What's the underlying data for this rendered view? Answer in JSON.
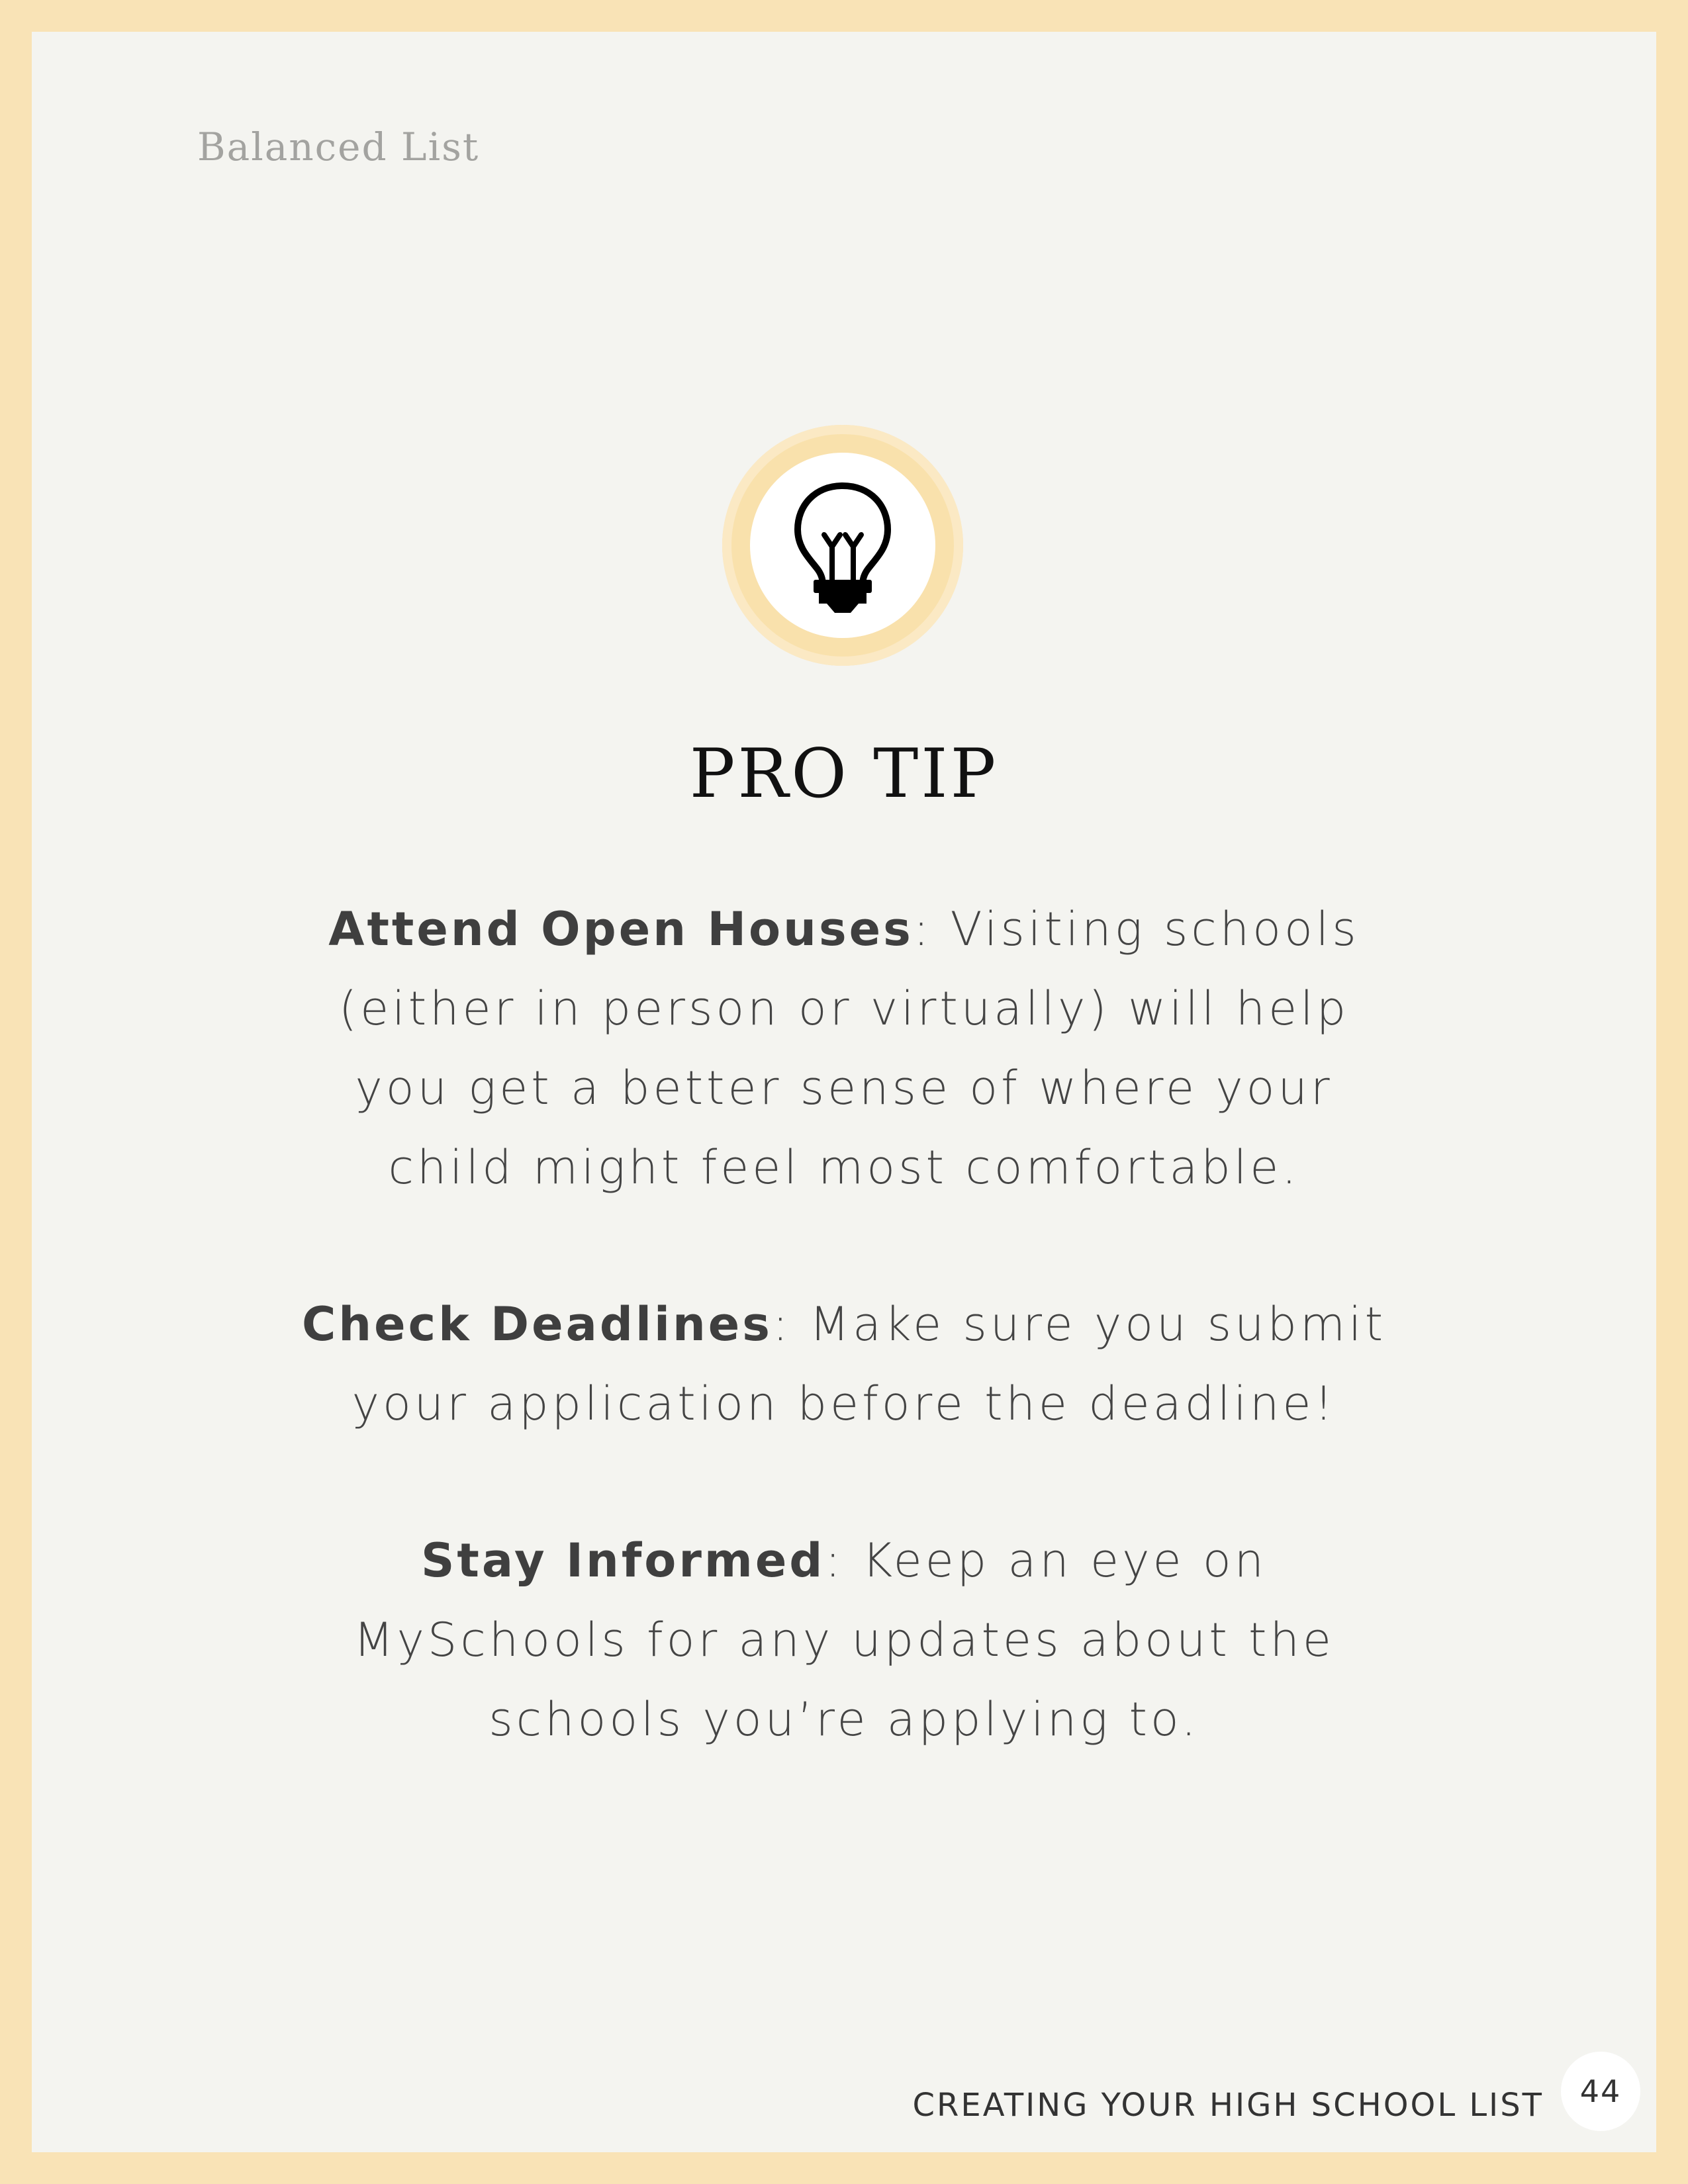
{
  "header": {
    "running_head": "Balanced List"
  },
  "tip": {
    "icon": "lightbulb-icon",
    "title": "PRO TIP",
    "items": [
      {
        "label": "Attend Open Houses",
        "text": ": Visiting schools (either in person or virtually) will help you get a better sense of where your child might feel most comfortable."
      },
      {
        "label": "Check Deadlines",
        "text": ": Make sure you submit your application before the deadline!"
      },
      {
        "label": "Stay Informed",
        "text": ": Keep an eye on MySchools for any updates about the schools you’re applying to."
      }
    ]
  },
  "footer": {
    "section_label": "CREATING YOUR HIGH SCHOOL LIST",
    "page_number": "44"
  },
  "colors": {
    "border": "#f9e3b6",
    "page": "#f4f4f0",
    "badge_ring": "#f9e1ac"
  }
}
